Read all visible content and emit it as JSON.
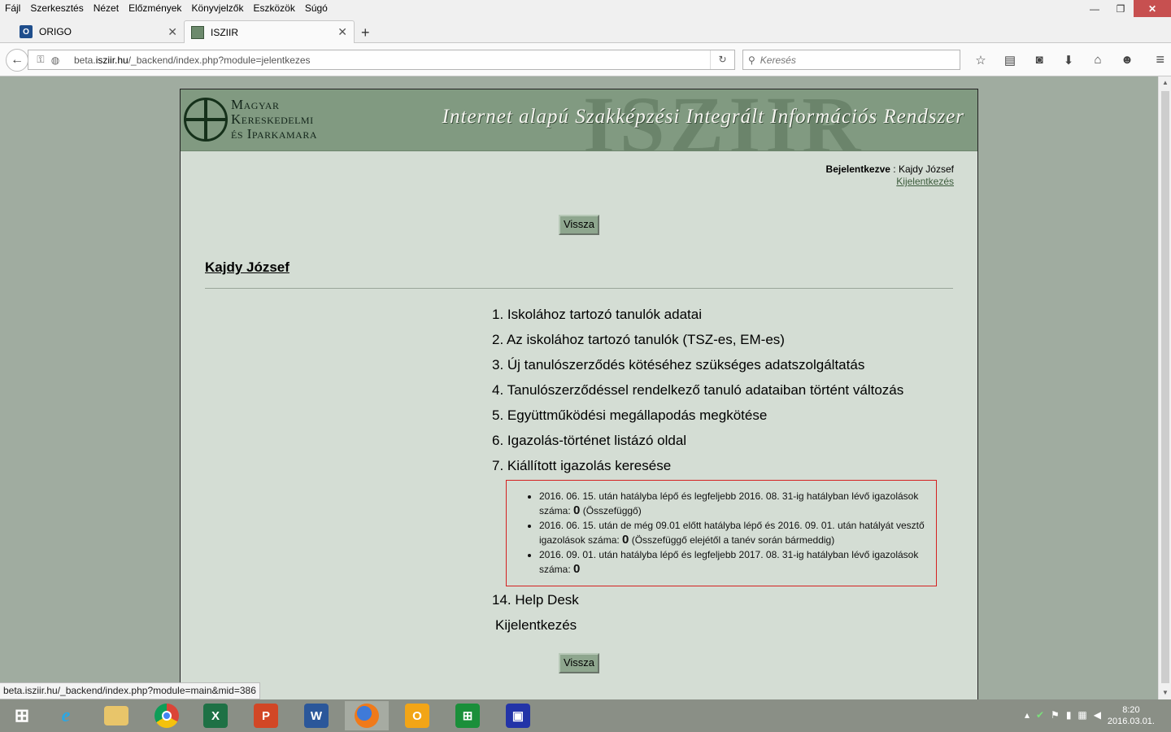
{
  "menubar": {
    "items": [
      "Fájl",
      "Szerkesztés",
      "Nézet",
      "Előzmények",
      "Könyvjelzők",
      "Eszközök",
      "Súgó"
    ]
  },
  "window_controls": {
    "minimize": "—",
    "restore": "❐",
    "close": "✕"
  },
  "tabs": [
    {
      "title": "ORIGO",
      "favicon": "origo-icon",
      "active": false
    },
    {
      "title": "ISZIIR",
      "favicon": "isziir-icon",
      "active": true
    }
  ],
  "new_tab_label": "+",
  "navbar": {
    "url_prefix": "beta.",
    "url_domain": "isziir.hu",
    "url_path": "/_backend/index.php?module=jelentkezes",
    "search_placeholder": "Keresés"
  },
  "banner": {
    "org_line1": "Magyar",
    "org_line2": "Kereskedelmi",
    "org_line3": "és Iparkamara",
    "watermark": "ISZIIR",
    "system_title": "Internet alapú Szakképzési Integrált Információs Rendszer"
  },
  "login": {
    "label": "Bejelentkezve",
    "separator": " : ",
    "user": "Kajdy József",
    "logout_link": "Kijelentkezés"
  },
  "buttons": {
    "back_top": "Vissza",
    "back_bottom": "Vissza"
  },
  "user_name": "Kajdy József",
  "menu": [
    "1. Iskolához tartozó tanulók adatai",
    "2. Az iskolához tartozó tanulók (TSZ-es, EM-es)",
    "3. Új tanulószerződés kötéséhez szükséges adatszolgáltatás",
    "4. Tanulószerződéssel rendelkező tanuló adataiban történt változás",
    "5. Együttműködési megállapodás megkötése",
    "6. Igazolás-történet listázó oldal",
    "7. Kiállított igazolás keresése"
  ],
  "notice": [
    {
      "text": "2016. 06. 15. után hatályba lépő és legfeljebb 2016. 08. 31-ig hatályban lévő igazolások száma: ",
      "count": "0",
      "suffix": " (Összefüggő)"
    },
    {
      "text": "2016. 06. 15. után de még 09.01 előtt hatályba lépő és 2016. 09. 01. után hatályát vesztő igazolások száma: ",
      "count": "0",
      "suffix": " (Összefüggő elejétől a tanév során bármeddig)"
    },
    {
      "text": "2016. 09. 01. után hatályba lépő és legfeljebb 2017. 08. 31-ig hatályban lévő igazolások száma: ",
      "count": "0",
      "suffix": ""
    }
  ],
  "help_desk": "14. Help Desk",
  "logout_item": "Kijelentkezés",
  "status_url": "beta.isziir.hu/_backend/index.php?module=main&mid=386",
  "taskbar": {
    "apps": [
      "windows-start",
      "internet-explorer",
      "file-explorer",
      "chrome",
      "excel",
      "powerpoint",
      "word",
      "firefox",
      "outlook",
      "store",
      "save-app"
    ],
    "time": "8:20",
    "date": "2016.03.01."
  },
  "colors": {
    "page_bg": "#a0aca0",
    "content_bg": "#d4ddd4",
    "banner_bg": "#819a81",
    "notice_border": "#d42020",
    "button_bg": "#8ea68e"
  }
}
